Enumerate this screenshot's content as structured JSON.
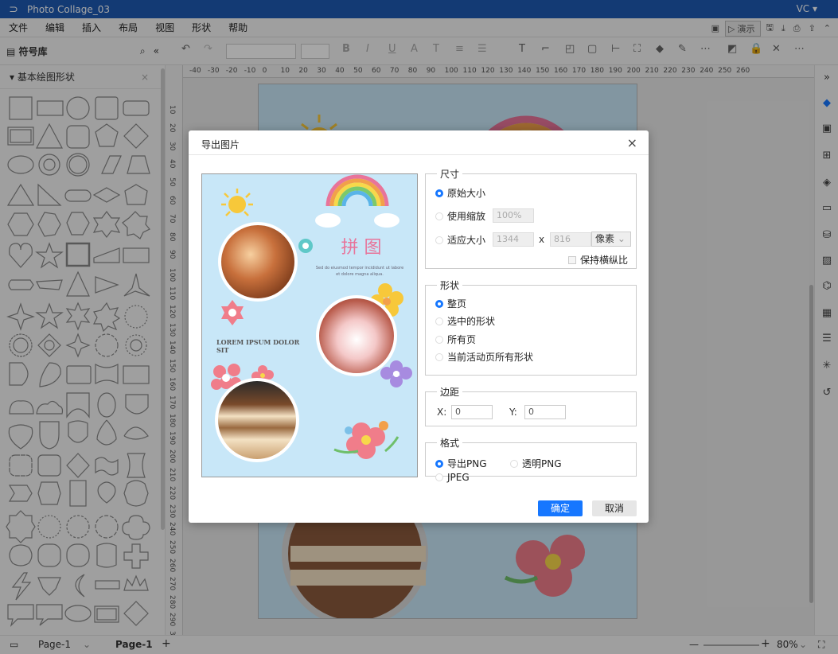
{
  "window": {
    "title": "Photo Collage_03",
    "user": "VC ▾"
  },
  "menu": [
    "文件",
    "编辑",
    "插入",
    "布局",
    "视图",
    "形状",
    "帮助"
  ],
  "menu_right": {
    "present": "演示"
  },
  "library": {
    "title": "符号库",
    "group": "基本绘图形状"
  },
  "ruler_top": [
    "-40",
    "-30",
    "-20",
    "-10",
    "0",
    "10",
    "20",
    "30",
    "40",
    "50",
    "60",
    "70",
    "80",
    "90",
    "100",
    "110",
    "120",
    "130",
    "140",
    "150",
    "160",
    "170",
    "180",
    "190",
    "200",
    "210",
    "220",
    "230",
    "240",
    "250",
    "260"
  ],
  "ruler_left": [
    "10",
    "20",
    "30",
    "40",
    "50",
    "60",
    "70",
    "80",
    "90",
    "100",
    "110",
    "120",
    "130",
    "140",
    "150",
    "160",
    "170",
    "180",
    "190",
    "200",
    "210",
    "220",
    "230",
    "240",
    "250",
    "260",
    "270",
    "280",
    "290",
    "300"
  ],
  "status": {
    "page_tab_inactive": "Page-1",
    "page_tab_active": "Page-1",
    "zoom": "80%"
  },
  "dialog": {
    "title": "导出图片",
    "size": {
      "legend": "尺寸",
      "original": "原始大小",
      "scale": "使用缩放",
      "scale_value": "100%",
      "fit": "适应大小",
      "width": "1344",
      "times": "x",
      "height": "816",
      "unit": "像素",
      "keep_ratio": "保持横纵比"
    },
    "shape": {
      "legend": "形状",
      "whole_page": "整页",
      "selected": "选中的形状",
      "all_pages": "所有页",
      "current_page_shapes": "当前活动页所有形状"
    },
    "margin": {
      "legend": "边距",
      "x_label": "X:",
      "x_value": "0",
      "y_label": "Y:",
      "y_value": "0"
    },
    "format": {
      "legend": "格式",
      "png": "导出PNG",
      "transparent_png": "透明PNG",
      "jpeg": "JPEG"
    },
    "ok": "确定",
    "cancel": "取消",
    "preview": {
      "heading": "拼 图",
      "body": "Sed do eiusmod tempor incididunt ut labore et dolore magna aliqua.",
      "caption": "LOREM IPSUM DOLOR SIT"
    }
  },
  "colors": {
    "accent": "#1677ff",
    "titlebar": "#1e5ab3",
    "preview_bg": "#c8e7f8",
    "heading_pink": "#e8749a"
  }
}
